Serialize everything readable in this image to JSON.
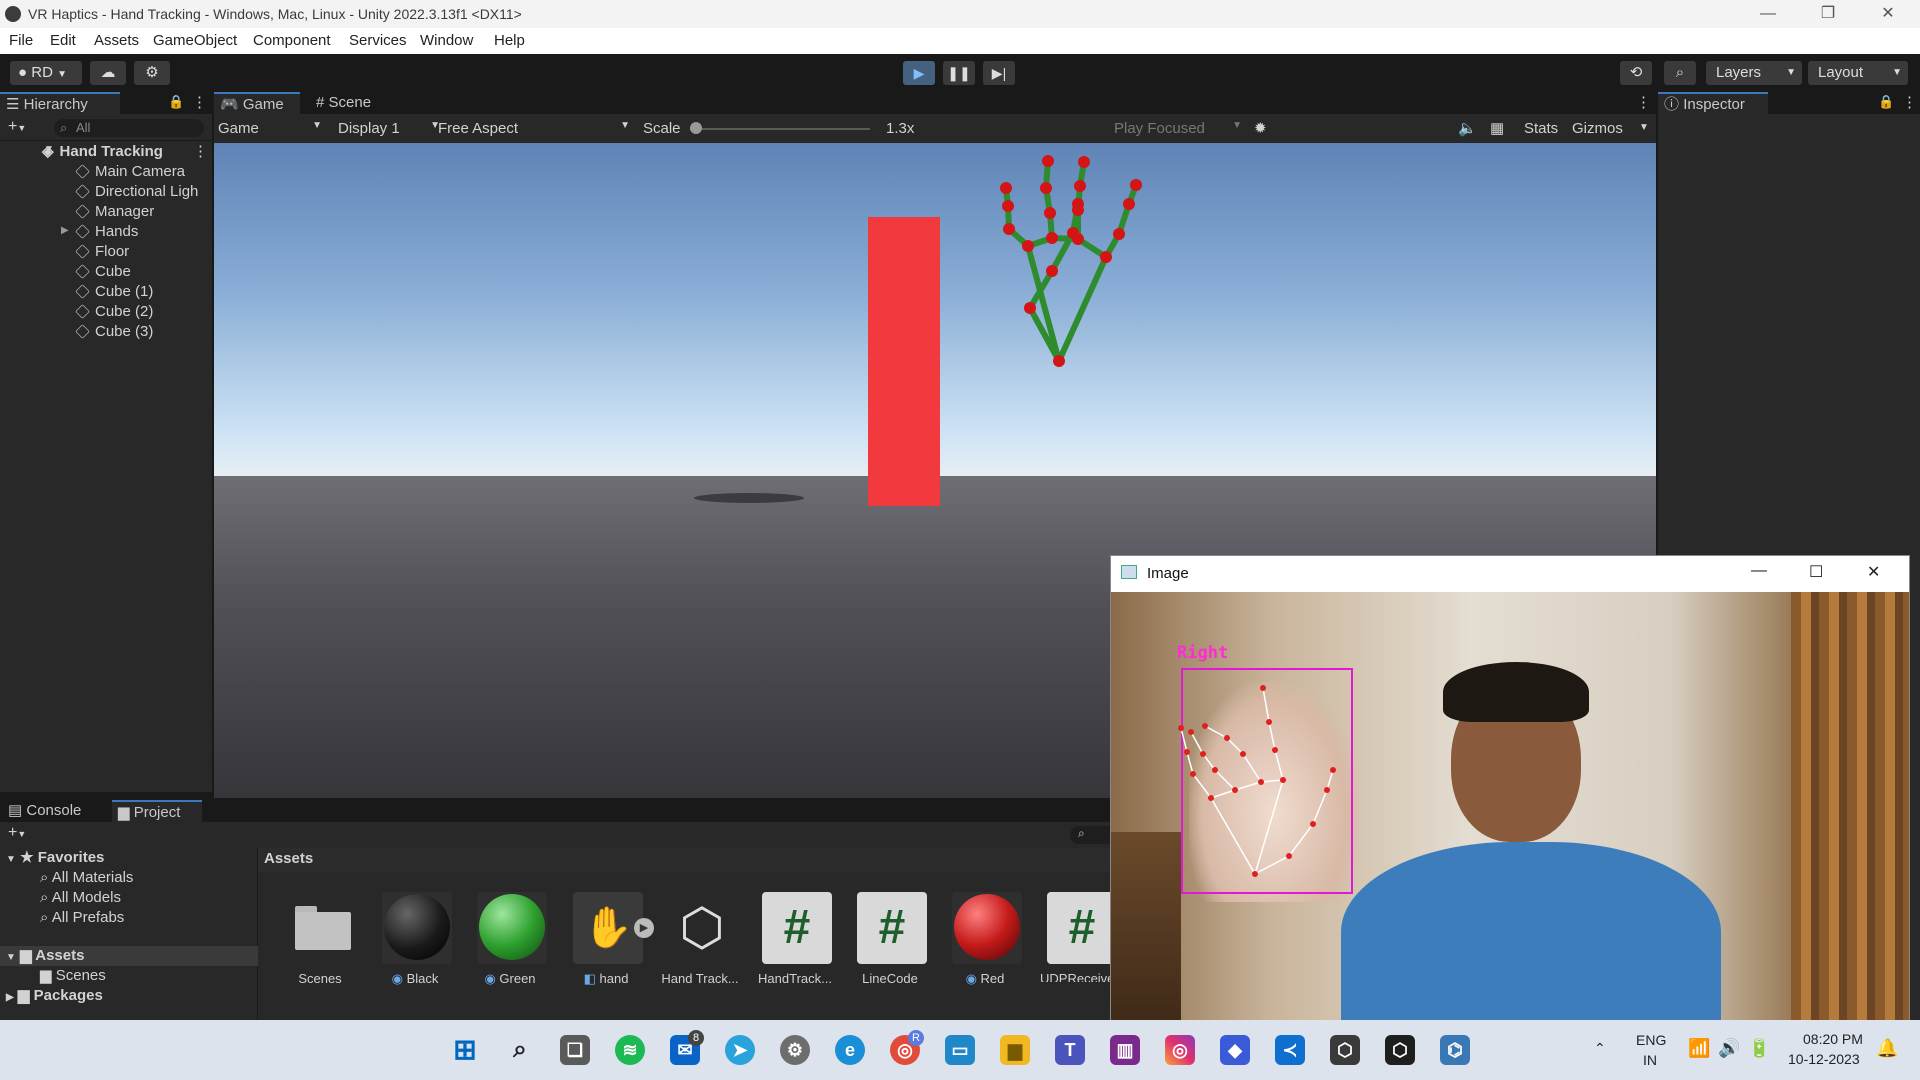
{
  "window": {
    "title": "VR Haptics - Hand Tracking - Windows, Mac, Linux - Unity 2022.3.13f1 <DX11>",
    "minimize": "—",
    "restore": "❐",
    "close": "✕"
  },
  "menu": [
    "File",
    "Edit",
    "Assets",
    "GameObject",
    "Component",
    "Services",
    "Window",
    "Help"
  ],
  "toolbar": {
    "account": "RD",
    "layers": "Layers",
    "layout": "Layout",
    "play_icon": "play-icon",
    "pause_icon": "pause-icon",
    "step_icon": "step-icon"
  },
  "hierarchy": {
    "tab": "Hierarchy",
    "search_placeholder": "All",
    "scene": "Hand Tracking",
    "items": [
      "Main Camera",
      "Directional Ligh",
      "Manager",
      "Hands",
      "Floor",
      "Cube",
      "Cube (1)",
      "Cube (2)",
      "Cube (3)"
    ]
  },
  "game_tabs": {
    "game": "Game",
    "scene": "Scene"
  },
  "game_toolbar": {
    "view": "Game",
    "display": "Display 1",
    "aspect": "Free Aspect",
    "scale_label": "Scale",
    "scale_value": "1.3x",
    "play_focused": "Play Focused",
    "stats": "Stats",
    "gizmos": "Gizmos"
  },
  "inspector": {
    "tab": "Inspector"
  },
  "bottom_tabs": {
    "console": "Console",
    "project": "Project"
  },
  "project": {
    "favorites": "Favorites",
    "fav_items": [
      "All Materials",
      "All Models",
      "All Prefabs"
    ],
    "assets": "Assets",
    "asset_children": [
      "Scenes"
    ],
    "packages": "Packages",
    "breadcrumb": "Assets",
    "asset_items": [
      {
        "label": "Scenes",
        "kind": "folder"
      },
      {
        "label": "Black",
        "kind": "material",
        "color": "#1a1a1a"
      },
      {
        "label": "Green",
        "kind": "material",
        "color": "#2fa12f"
      },
      {
        "label": "hand",
        "kind": "model"
      },
      {
        "label": "Hand Track...",
        "kind": "unity"
      },
      {
        "label": "HandTrack...",
        "kind": "script"
      },
      {
        "label": "LineCode",
        "kind": "script"
      },
      {
        "label": "Red",
        "kind": "material",
        "color": "#c41a1a"
      },
      {
        "label": "UDPReceive",
        "kind": "script"
      }
    ]
  },
  "camera_window": {
    "title": "Image",
    "hand_label": "Right",
    "hand_label_color": "#ff2bd6",
    "box_color": "#e01ad2"
  },
  "colors": {
    "cube": "#f23a3e",
    "joint": "#d41515",
    "bone": "#2e8b2e",
    "accent": "#3a79bb"
  },
  "taskbar": {
    "lang1": "ENG",
    "lang2": "IN",
    "time": "08:20 PM",
    "date": "10-12-2023",
    "mail_badge": "8",
    "chrome_badge": "R"
  }
}
